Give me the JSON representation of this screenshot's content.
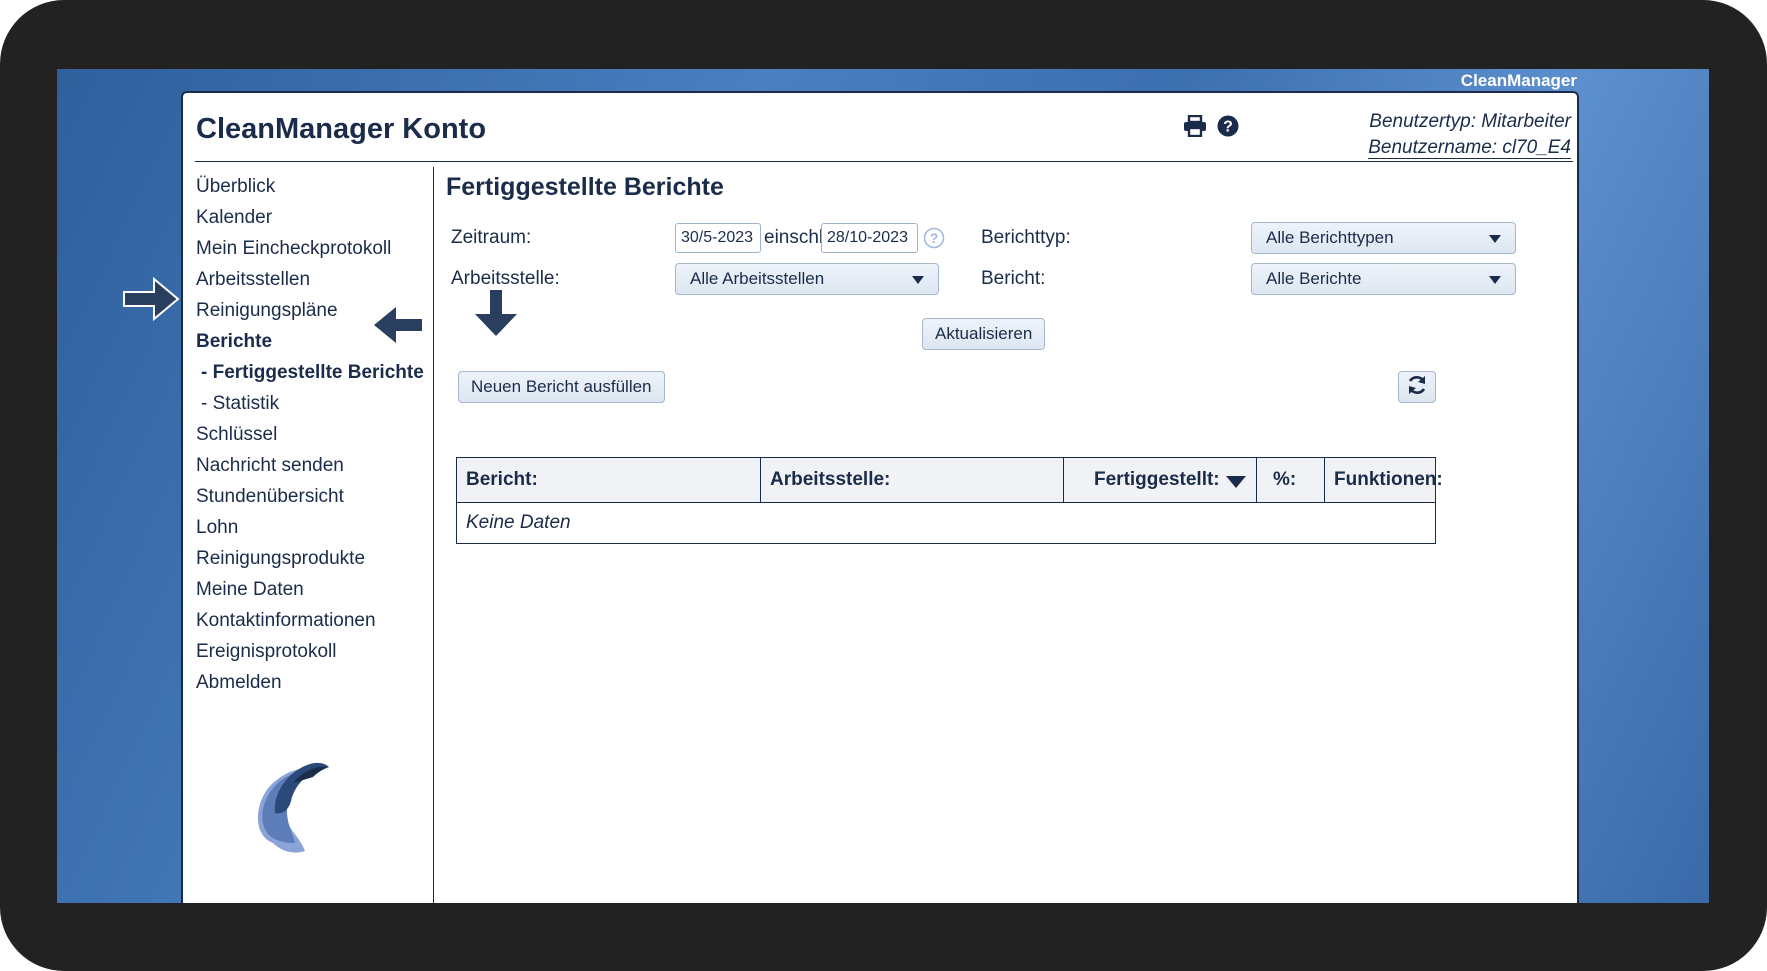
{
  "brand": "CleanManager",
  "app_title": "CleanManager Konto",
  "user": {
    "type": "Benutzertyp: Mitarbeiter",
    "name": "Benutzername: cl70_E4"
  },
  "toolbar_icons": [
    "print-icon",
    "help-icon"
  ],
  "nav": {
    "items": [
      {
        "label": "Überblick"
      },
      {
        "label": "Kalender"
      },
      {
        "label": "Mein Eincheckprotokoll"
      },
      {
        "label": "Arbeitsstellen"
      },
      {
        "label": "Reinigungspläne"
      },
      {
        "label": "Berichte"
      },
      {
        "label": "- Fertiggestellte Berichte"
      },
      {
        "label": "- Statistik"
      },
      {
        "label": "Schlüssel"
      },
      {
        "label": "Nachricht senden"
      },
      {
        "label": "Stundenübersicht"
      },
      {
        "label": "Lohn"
      },
      {
        "label": "Reinigungsprodukte"
      },
      {
        "label": "Meine Daten"
      },
      {
        "label": "Kontaktinformationen"
      },
      {
        "label": "Ereignisprotokoll"
      },
      {
        "label": "Abmelden"
      }
    ]
  },
  "main": {
    "title": "Fertiggestellte Berichte",
    "filters": {
      "period_label": "Zeitraum:",
      "date_from": "30/5-2023",
      "inclusive_label": "einschl.",
      "date_to": "28/10-2023",
      "report_type_label": "Berichttyp:",
      "report_type_value": "Alle Berichttypen",
      "workplace_label": "Arbeitsstelle:",
      "workplace_value": "Alle Arbeitsstellen",
      "report_label": "Bericht:",
      "report_value": "Alle Berichte"
    },
    "update_button": "Aktualisieren",
    "new_report_button": "Neuen Bericht ausfüllen",
    "table": {
      "headers": [
        "Bericht:",
        "Arbeitsstelle:",
        "Fertiggestellt:",
        "%:",
        "Funktionen:"
      ],
      "empty_text": "Keine Daten"
    }
  },
  "colors": {
    "navy": "#1b2c4a",
    "background_blue": "#3c6faf",
    "annotation_arrow": "#2a3f5f"
  }
}
